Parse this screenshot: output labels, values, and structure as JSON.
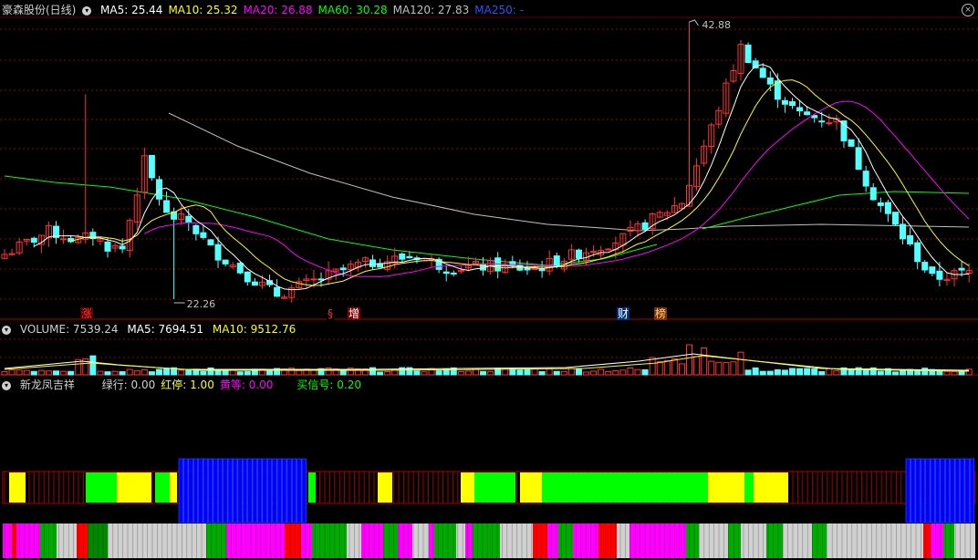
{
  "main": {
    "title": "豪森股份(日线)",
    "ma": [
      {
        "label": "MA5: 25.44",
        "color": "#ffffff"
      },
      {
        "label": "MA10: 25.32",
        "color": "#ffff00"
      },
      {
        "label": "MA20: 26.88",
        "color": "#ff00ff"
      },
      {
        "label": "MA60: 30.28",
        "color": "#00ff00"
      },
      {
        "label": "MA120: 27.83",
        "color": "#c0c0c0"
      },
      {
        "label": "MA250: -",
        "color": "#3050ff"
      }
    ],
    "high_label": "42.88",
    "low_label": "22.26",
    "markers": [
      {
        "text": "涨",
        "color": "#ff3030",
        "bg": "#500000"
      },
      {
        "text": "§",
        "color": "#ff3030",
        "bg": "#000000"
      },
      {
        "text": "增",
        "color": "#ffffff",
        "bg": "#800000"
      },
      {
        "text": "财",
        "color": "#ffffff",
        "bg": "#003080"
      },
      {
        "text": "榜",
        "color": "#ffd080",
        "bg": "#803000"
      }
    ]
  },
  "volume": {
    "title": "VOLUME: 7539.24",
    "ma5": "MA5: 7694.51",
    "ma10": "MA10: 9512.76"
  },
  "indicator": {
    "name": "新龙凤吉祥",
    "items": [
      {
        "label": "绿行: 0.00",
        "color": "#d0d0d0"
      },
      {
        "label": "红停: 1.00",
        "color": "#ffff00"
      },
      {
        "label": "黄等: 0.00",
        "color": "#ff00ff"
      },
      {
        "label": "买信号: 0.20",
        "color": "#00ff00"
      }
    ]
  },
  "colors": {
    "up": "#ff3232",
    "down": "#54ffff",
    "grid": "#8a0000",
    "ma5": "#ffffff",
    "ma10": "#ffff00",
    "ma20": "#ff00ff",
    "ma60": "#00ff00",
    "ma120": "#c0c0c0"
  }
}
